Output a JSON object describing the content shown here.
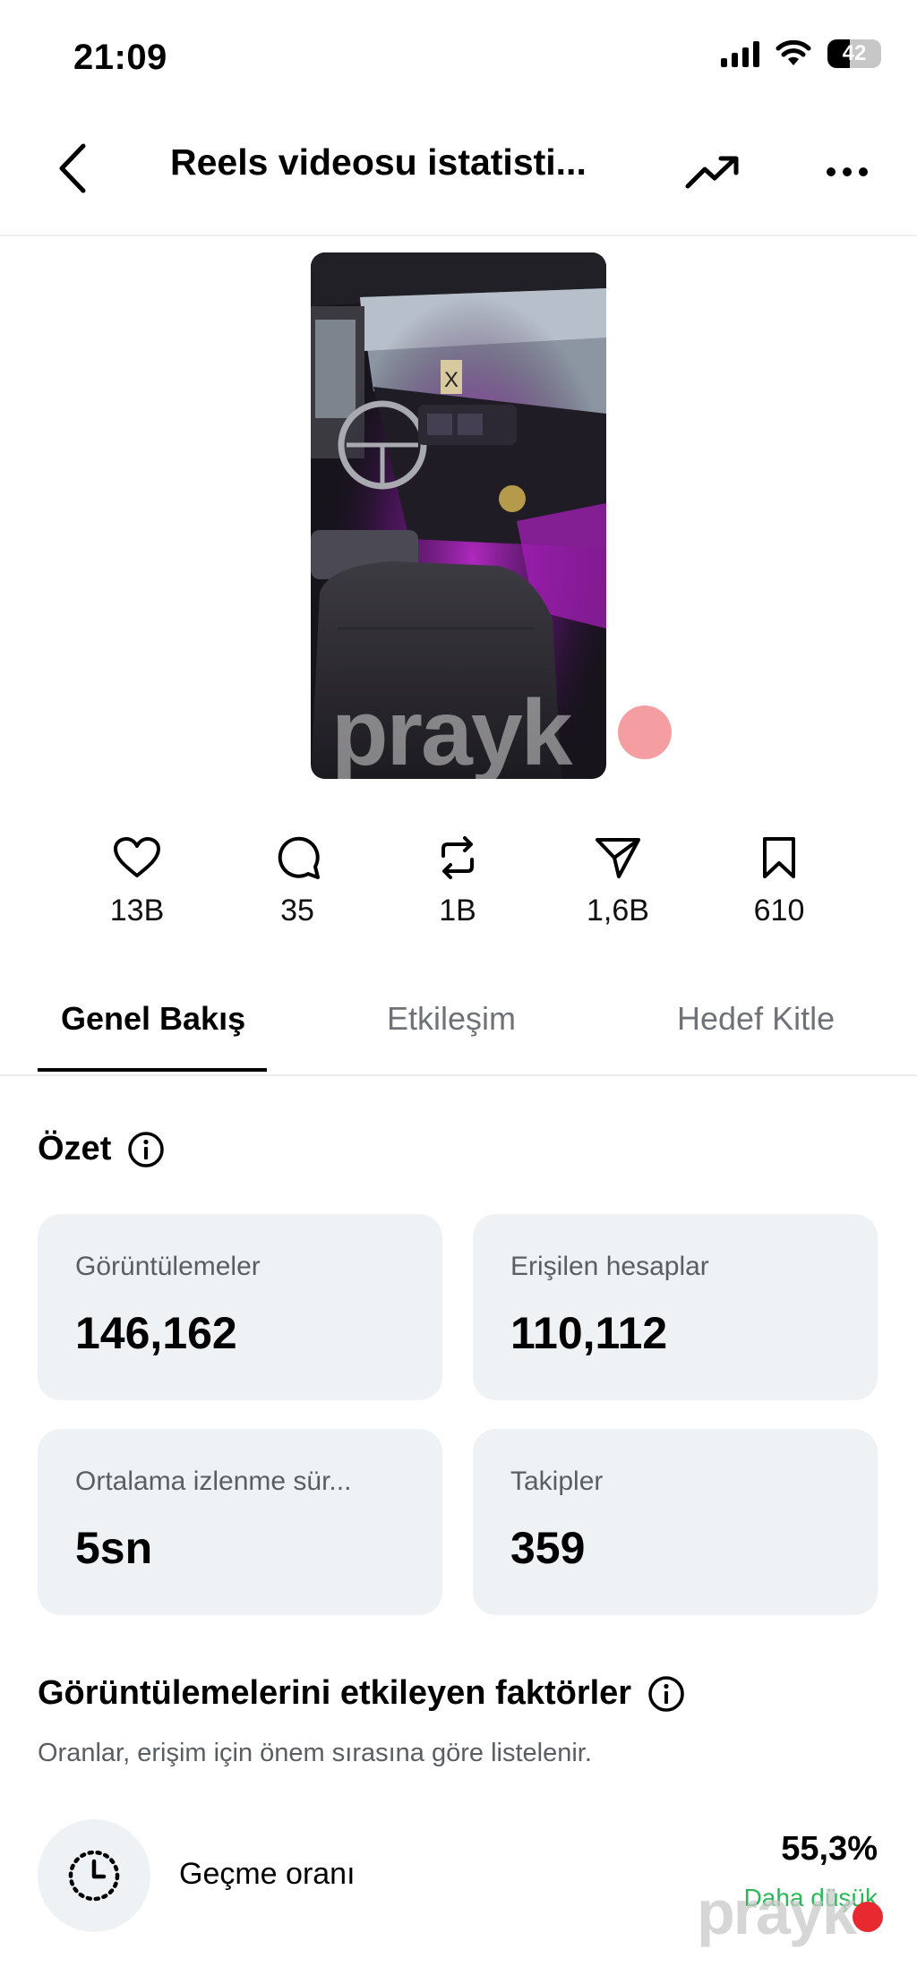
{
  "status": {
    "time": "21:09",
    "battery": "42",
    "battery_level": 0.42
  },
  "nav": {
    "title": "Reels videosu istatisti..."
  },
  "stats": [
    {
      "icon": "heart-icon",
      "value": "13B"
    },
    {
      "icon": "comment-icon",
      "value": "35"
    },
    {
      "icon": "repost-icon",
      "value": "1B"
    },
    {
      "icon": "share-icon",
      "value": "1,6B"
    },
    {
      "icon": "bookmark-icon",
      "value": "610"
    }
  ],
  "tabs": [
    {
      "label": "Genel Bakış",
      "active": true
    },
    {
      "label": "Etkileşim",
      "active": false
    },
    {
      "label": "Hedef Kitle",
      "active": false
    }
  ],
  "summary": {
    "title": "Özet",
    "cards": [
      {
        "label": "Görüntülemeler",
        "value": "146,162"
      },
      {
        "label": "Erişilen hesaplar",
        "value": "110,112"
      },
      {
        "label": "Ortalama izlenme sür...",
        "value": "5sn"
      },
      {
        "label": "Takipler",
        "value": "359"
      }
    ]
  },
  "factors": {
    "title": "Görüntülemelerini etkileyen faktörler",
    "subtitle": "Oranlar, erişim için önem sırasına göre listelenir.",
    "items": [
      {
        "icon": "clock-icon",
        "label": "Geçme oranı",
        "value": "55,3%",
        "status": "Daha düşük"
      }
    ]
  },
  "watermark": {
    "text": "prayk"
  },
  "colors": {
    "card_bg": "#eff2f5",
    "secondary_text": "#5a5e63",
    "positive": "#2cb857",
    "watermark_dot": "#e8292f"
  }
}
